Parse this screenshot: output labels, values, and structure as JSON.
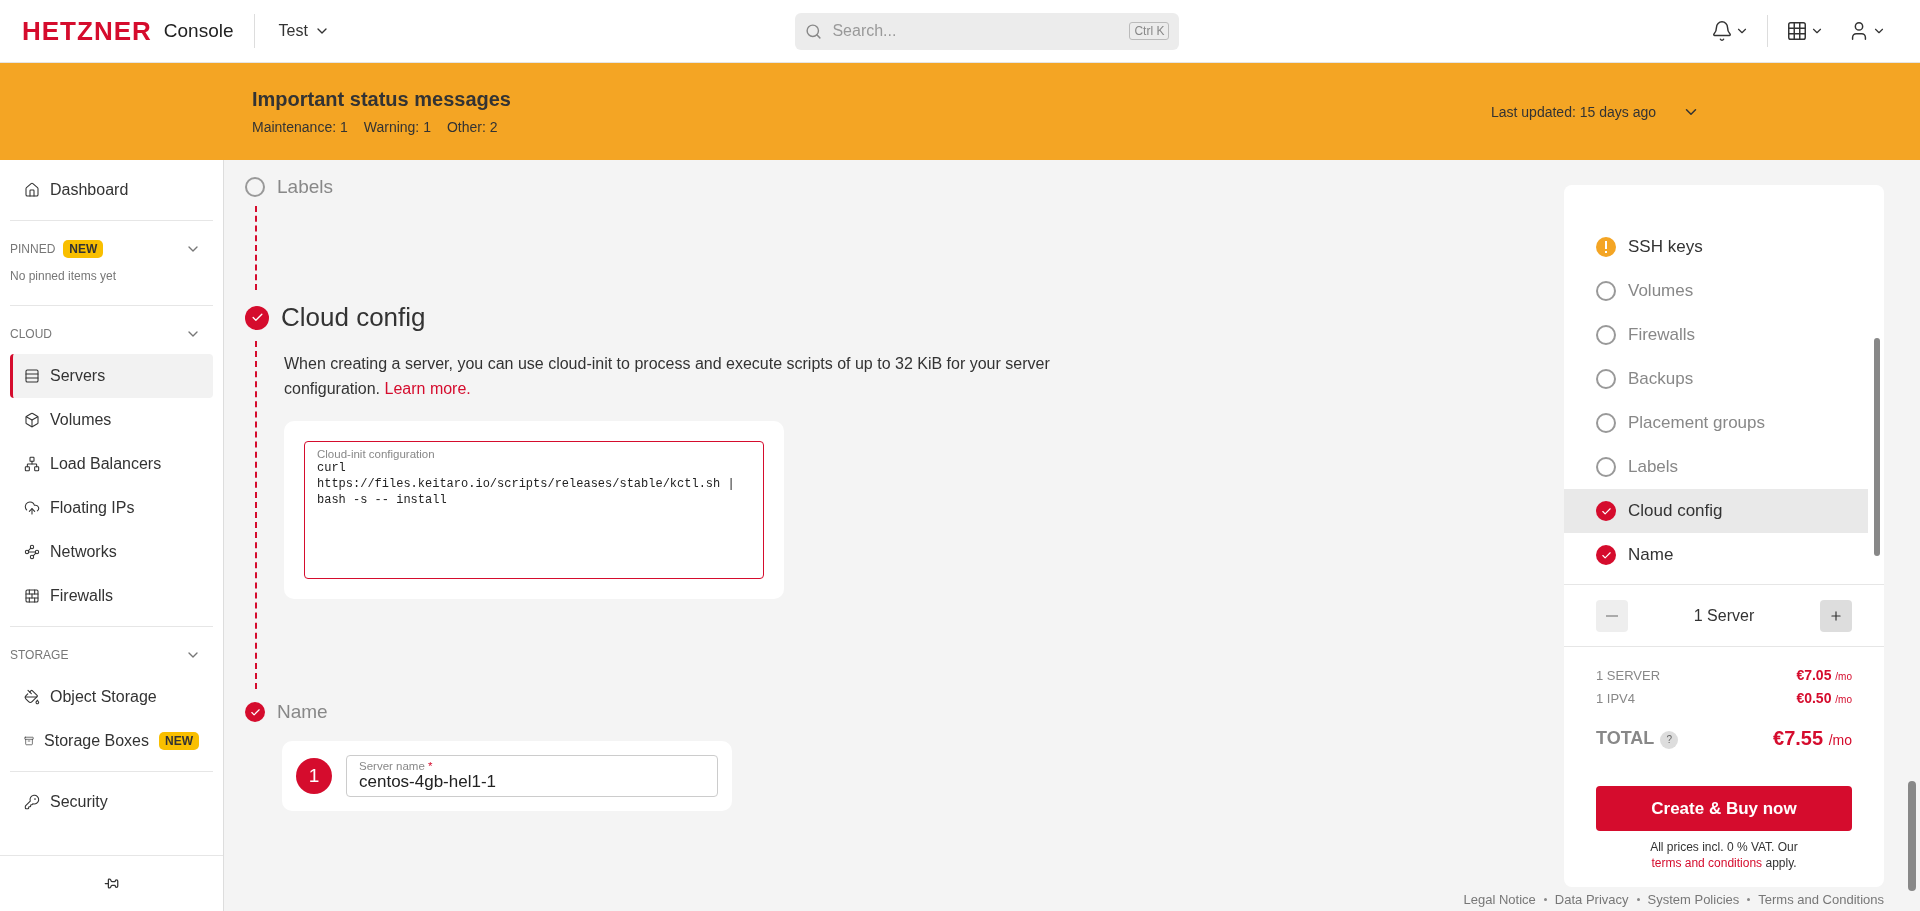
{
  "header": {
    "logo": "HETZNER",
    "product": "Console",
    "project": "Test",
    "search": {
      "placeholder": "Search...",
      "shortcut": "Ctrl K"
    }
  },
  "status_banner": {
    "title": "Important status messages",
    "counts": [
      {
        "label": "Maintenance:",
        "value": "1"
      },
      {
        "label": "Warning:",
        "value": "1"
      },
      {
        "label": "Other:",
        "value": "2"
      }
    ],
    "last_updated_label": "Last updated:",
    "last_updated": "15 days ago"
  },
  "sidebar": {
    "top": [
      {
        "label": "Dashboard",
        "selected": false
      }
    ],
    "sections": [
      {
        "title": "PINNED",
        "badge": "NEW",
        "empty": "No pinned items yet"
      },
      {
        "title": "CLOUD",
        "items": [
          {
            "label": "Servers",
            "selected": true
          },
          {
            "label": "Volumes",
            "selected": false
          },
          {
            "label": "Load Balancers",
            "selected": false
          },
          {
            "label": "Floating IPs",
            "selected": false
          },
          {
            "label": "Networks",
            "selected": false
          },
          {
            "label": "Firewalls",
            "selected": false
          }
        ]
      },
      {
        "title": "STORAGE",
        "items": [
          {
            "label": "Object Storage",
            "selected": false
          },
          {
            "label": "Storage Boxes",
            "badge": "NEW",
            "selected": false
          }
        ]
      }
    ],
    "bottom": [
      {
        "label": "Security",
        "selected": false
      }
    ]
  },
  "steps": [
    {
      "kind": "collapsed",
      "title": "Labels",
      "checked": false
    },
    {
      "kind": "cloud_config",
      "title": "Cloud config",
      "checked": true,
      "description": "When creating a server, you can use cloud-init to process and execute scripts of up to 32 KiB for your server configuration. ",
      "link": "Learn more.",
      "field": {
        "label": "Cloud-init configuration",
        "value": "curl\nhttps://files.keitaro.io/scripts/releases/stable/kctl.sh |\nbash -s -- install"
      }
    },
    {
      "kind": "name",
      "title": "Name",
      "checked": true,
      "number": "1",
      "field": {
        "label": "Server name",
        "required": "*",
        "value": "centos-4gb-hel1-1"
      }
    }
  ],
  "summary": {
    "steps": [
      {
        "kind": "warning",
        "label": "SSH keys",
        "checked": false,
        "selected": false
      },
      {
        "kind": "step",
        "label": "Volumes",
        "checked": false,
        "selected": false
      },
      {
        "kind": "step",
        "label": "Firewalls",
        "checked": false,
        "selected": false
      },
      {
        "kind": "step",
        "label": "Backups",
        "checked": false,
        "selected": false
      },
      {
        "kind": "step",
        "label": "Placement groups",
        "checked": false,
        "selected": false
      },
      {
        "kind": "step",
        "label": "Labels",
        "checked": false,
        "selected": false
      },
      {
        "kind": "step",
        "label": "Cloud config",
        "checked": true,
        "selected": true
      },
      {
        "kind": "step",
        "label": "Name",
        "checked": true,
        "selected": false
      }
    ],
    "counter": {
      "label": "1 Server",
      "minus_disabled": true
    },
    "prices": [
      {
        "label": "1 SERVER",
        "price": "€7.05",
        "unit": "/mo"
      },
      {
        "label": "1 IPV4",
        "price": "€0.50",
        "unit": "/mo"
      }
    ],
    "total": {
      "label": "TOTAL",
      "help": "?",
      "price": "€7.55",
      "unit": "/mo"
    },
    "button": "Create & Buy now",
    "note": {
      "before": "All prices incl. 0 % VAT. Our ",
      "link": "terms and conditions",
      "after": " apply."
    }
  },
  "footer_links": [
    "Legal Notice",
    "Data Privacy",
    "System Policies",
    "Terms and Conditions"
  ]
}
